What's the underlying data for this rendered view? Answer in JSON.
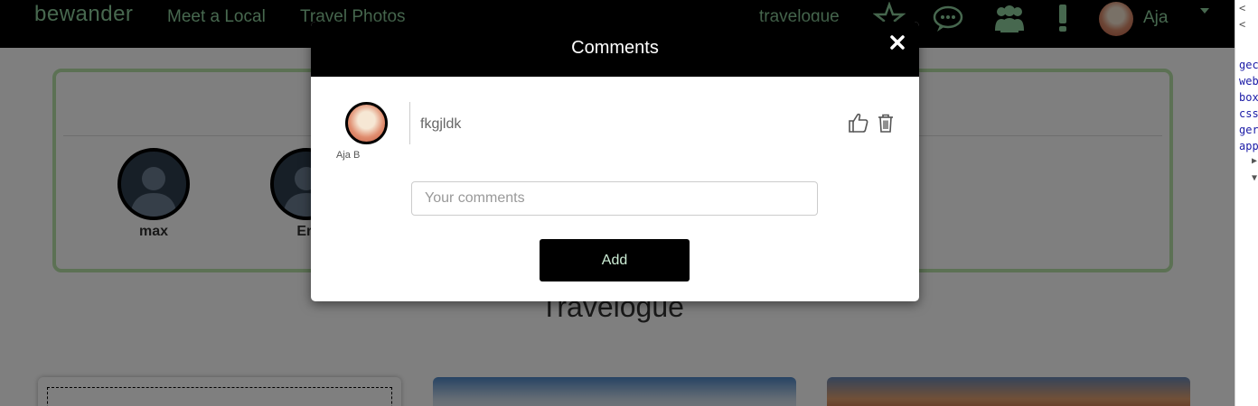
{
  "navbar": {
    "logo": "bewander",
    "links": [
      "Meet a Local",
      "Travel Photos",
      "travelogue"
    ],
    "icons": [
      "star-icon",
      "chat-bubble-icon",
      "users-icon",
      "exclamation-icon"
    ],
    "username": "Aja",
    "accent_color": "#8fd19e"
  },
  "friends": {
    "items": [
      {
        "name": "max"
      },
      {
        "name": "Eri"
      }
    ],
    "border_color": "#b9e3a8"
  },
  "section": {
    "title": "Travelogue"
  },
  "modal": {
    "title": "Comments",
    "close_icon": "close-x-icon",
    "comment": {
      "author": "Aja B",
      "text": "fkgjldk"
    },
    "input": {
      "placeholder": "Your comments",
      "value": ""
    },
    "add_label": "Add"
  },
  "devtools": {
    "lines": [
      "<",
      "<",
      "gec",
      "web",
      "box",
      "css",
      "ger",
      "app",
      "▶",
      "▼"
    ]
  }
}
